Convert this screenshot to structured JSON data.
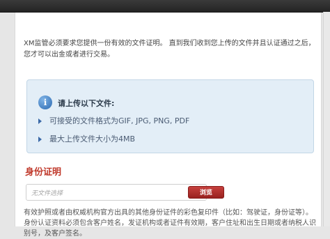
{
  "intro": "XM监管必须要求您提供一份有效的文件证明。 直到我们收到您上传的文件并且认证通过之后，您才可以出金或者进行交易。",
  "info": {
    "title": "请上传以下文件:",
    "items": [
      {
        "label": "可接受的文件格式为GIF, JPG, PNG, PDF"
      },
      {
        "label": "最大上传文件大小为4MB"
      }
    ]
  },
  "id_section": {
    "title": "身份证明",
    "file_placeholder": "无文件选择",
    "browse_label": "浏览",
    "description": "有效护照或者由权威机构官方出具的其他身份证件的彩色复印件（比如：驾驶证，身份证等）。身份认证资料必须包含客户姓名，发证机构或者证件有效期，客户住址和出生日期或者纳税人识别号，及客户签名。"
  },
  "colors": {
    "accent_red": "#c0392b",
    "info_bg": "#e3eef7",
    "info_text": "#4a5b73"
  }
}
